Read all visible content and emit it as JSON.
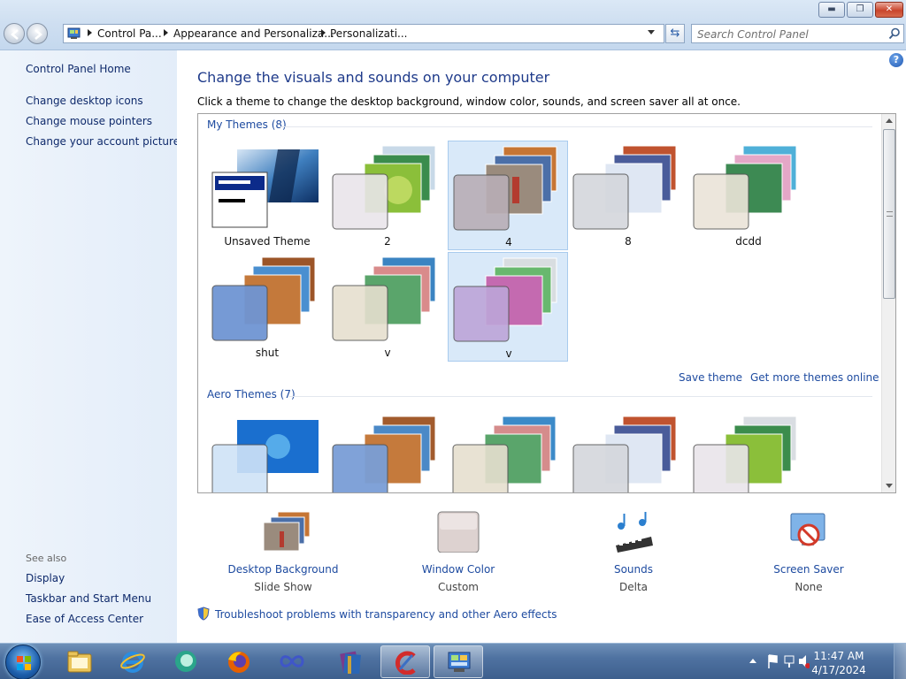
{
  "window": {
    "min_label": "▬",
    "max_label": "❐",
    "close_label": "✕"
  },
  "address_bar": {
    "crumbs": [
      "Control Pa...",
      "Appearance and Personaliza...",
      "Personalizati..."
    ]
  },
  "search": {
    "placeholder": "Search Control Panel"
  },
  "left_pane": {
    "home": "Control Panel Home",
    "links": [
      "Change desktop icons",
      "Change mouse pointers",
      "Change your account picture"
    ],
    "see_also_heading": "See also",
    "see_also": [
      "Display",
      "Taskbar and Start Menu",
      "Ease of Access Center"
    ]
  },
  "main": {
    "title": "Change the visuals and sounds on your computer",
    "subtitle": "Click a theme to change the desktop background, window color, sounds, and screen saver all at once.",
    "my_themes": {
      "heading": "My Themes (8)",
      "items": [
        {
          "name": "Unsaved Theme",
          "selected": false
        },
        {
          "name": "2",
          "selected": false
        },
        {
          "name": "4",
          "selected": true
        },
        {
          "name": "8",
          "selected": false
        },
        {
          "name": "dcdd",
          "selected": false
        },
        {
          "name": "shut",
          "selected": false
        },
        {
          "name": "v",
          "selected": false
        },
        {
          "name": "v",
          "selected": true
        }
      ]
    },
    "save_theme": "Save theme",
    "get_more": "Get more themes online",
    "aero_themes": {
      "heading": "Aero Themes (7)"
    },
    "bottom": [
      {
        "label": "Desktop Background",
        "value": "Slide Show"
      },
      {
        "label": "Window Color",
        "value": "Custom"
      },
      {
        "label": "Sounds",
        "value": "Delta"
      },
      {
        "label": "Screen Saver",
        "value": "None"
      }
    ],
    "troubleshoot": "Troubleshoot problems with transparency and other Aero effects"
  },
  "taskbar": {
    "time": "11:47 AM",
    "date": "4/17/2024"
  },
  "colors": {
    "link": "#1e4ba0",
    "title_blue": "#1e3a8a",
    "selection": "#d9e9f9"
  }
}
